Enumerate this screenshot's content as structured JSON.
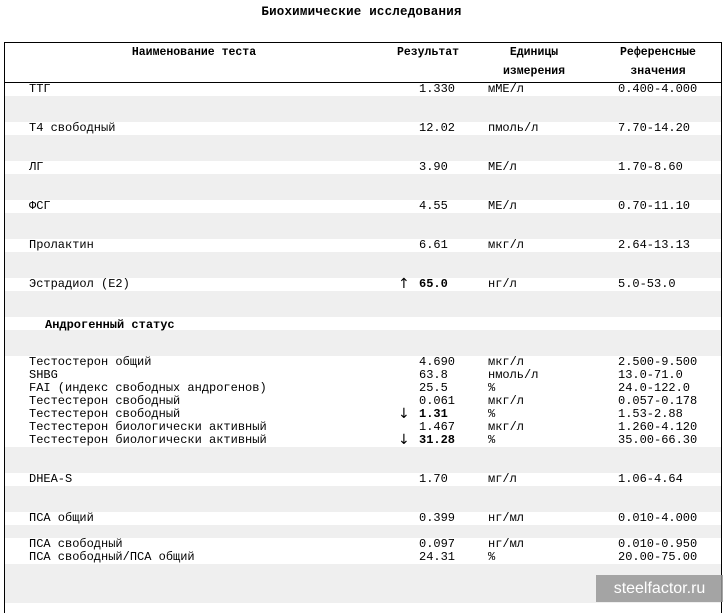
{
  "title": "Биохимические исследования",
  "header": {
    "name": "Наименование теста",
    "result": "Результат",
    "units_line1": "Единицы",
    "units_line2": "измерения",
    "ref_line1": "Референсные",
    "ref_line2": "значения"
  },
  "rows": [
    {
      "name": "ТТГ",
      "arrow": "",
      "value": "1.330",
      "bold": false,
      "unit": "мМЕ/л",
      "ref": "0.400-4.000"
    },
    {
      "name": "Т4 свободный",
      "arrow": "",
      "value": "12.02",
      "bold": false,
      "unit": "пмоль/л",
      "ref": "7.70-14.20"
    },
    {
      "name": "ЛГ",
      "arrow": "",
      "value": "3.90",
      "bold": false,
      "unit": "МЕ/л",
      "ref": "1.70-8.60"
    },
    {
      "name": "ФСГ",
      "arrow": "",
      "value": "4.55",
      "bold": false,
      "unit": "МЕ/л",
      "ref": "0.70-11.10"
    },
    {
      "name": "Пролактин",
      "arrow": "",
      "value": "6.61",
      "bold": false,
      "unit": "мкг/л",
      "ref": "2.64-13.13"
    },
    {
      "name": "Эстрадиол (Е2)",
      "arrow": "↑",
      "value": "65.0",
      "bold": true,
      "unit": "нг/л",
      "ref": "5.0-53.0"
    },
    {
      "name": "Тестостерон общий",
      "arrow": "",
      "value": "4.690",
      "bold": false,
      "unit": "мкг/л",
      "ref": "2.500-9.500"
    },
    {
      "name": "SHBG",
      "arrow": "",
      "value": "63.8",
      "bold": false,
      "unit": "нмоль/л",
      "ref": "13.0-71.0"
    },
    {
      "name": "FAI (индекс свободных андрогенов)",
      "arrow": "",
      "value": "25.5",
      "bold": false,
      "unit": "%",
      "ref": "24.0-122.0"
    },
    {
      "name": "Тестестерон свободный",
      "arrow": "",
      "value": "0.061",
      "bold": false,
      "unit": "мкг/л",
      "ref": "0.057-0.178"
    },
    {
      "name": "Тестестерон свободный",
      "arrow": "↓",
      "value": "1.31",
      "bold": true,
      "unit": "%",
      "ref": "1.53-2.88"
    },
    {
      "name": "Тестестерон биологически активный",
      "arrow": "",
      "value": "1.467",
      "bold": false,
      "unit": "мкг/л",
      "ref": "1.260-4.120"
    },
    {
      "name": "Тестестерон биологически активный",
      "arrow": "↓",
      "value": "31.28",
      "bold": true,
      "unit": "%",
      "ref": "35.00-66.30"
    },
    {
      "name": "DHEA-S",
      "arrow": "",
      "value": "1.70",
      "bold": false,
      "unit": "мг/л",
      "ref": "1.06-4.64"
    },
    {
      "name": "ПСА общий",
      "arrow": "",
      "value": "0.399",
      "bold": false,
      "unit": "нг/мл",
      "ref": "0.010-4.000"
    },
    {
      "name": "ПСА свободный",
      "arrow": "",
      "value": "0.097",
      "bold": false,
      "unit": "нг/мл",
      "ref": "0.010-0.950"
    },
    {
      "name": "ПСА свободный/ПСА общий",
      "arrow": "",
      "value": "24.31",
      "bold": false,
      "unit": "%",
      "ref": "20.00-75.00"
    }
  ],
  "section_androgen": "Андрогенный статус",
  "watermark": "steelfactor.ru"
}
